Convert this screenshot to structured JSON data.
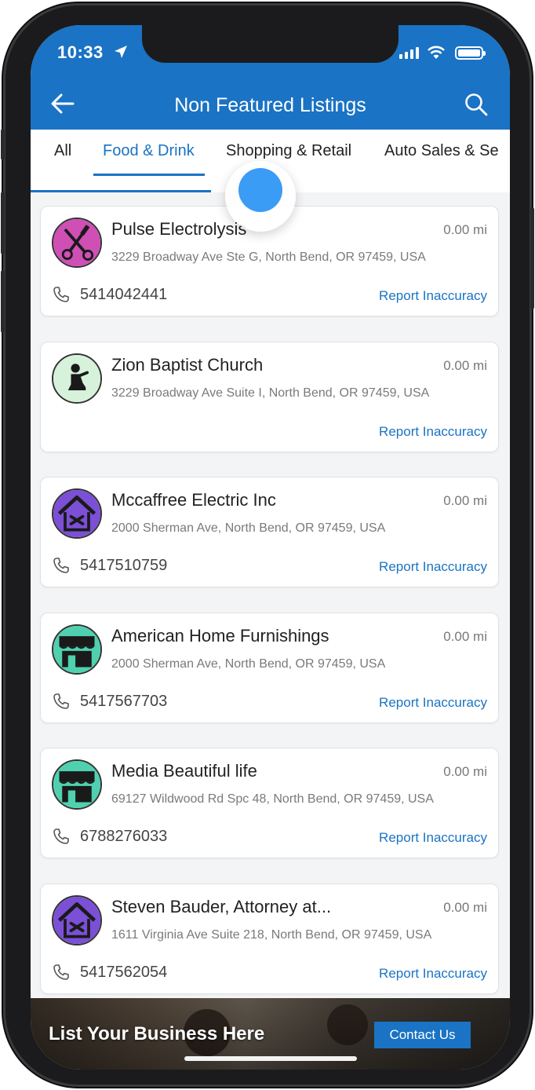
{
  "status_bar": {
    "time": "10:33"
  },
  "header": {
    "title": "Non Featured Listings"
  },
  "tabs": [
    {
      "label": "All"
    },
    {
      "label": "Food & Drink"
    },
    {
      "label": "Shopping & Retail"
    },
    {
      "label": "Auto Sales & Se"
    }
  ],
  "active_tab": "Food & Drink",
  "listings": [
    {
      "name": "Pulse Electrolysis",
      "distance": "0.00 mi",
      "address": "3229 Broadway Ave Ste G, North Bend, OR 97459, USA",
      "phone": "5414042441",
      "report_label": "Report Inaccuracy",
      "icon": "salon-scissors-icon"
    },
    {
      "name": "Zion Baptist Church",
      "distance": "0.00 mi",
      "address": "3229 Broadway Ave Suite I, North Bend, OR 97459, USA",
      "phone": "",
      "report_label": "Report Inaccuracy",
      "icon": "praying-person-icon"
    },
    {
      "name": "Mccaffree Electric Inc",
      "distance": "0.00 mi",
      "address": "2000 Sherman Ave, North Bend, OR 97459, USA",
      "phone": "5417510759",
      "report_label": "Report Inaccuracy",
      "icon": "home-services-icon"
    },
    {
      "name": "American Home Furnishings",
      "distance": "0.00 mi",
      "address": "2000 Sherman Ave, North Bend, OR 97459, USA",
      "phone": "5417567703",
      "report_label": "Report Inaccuracy",
      "icon": "storefront-icon"
    },
    {
      "name": "Media Beautiful life",
      "distance": "0.00 mi",
      "address": "69127 Wildwood Rd Spc 48, North Bend, OR 97459, USA",
      "phone": "6788276033",
      "report_label": "Report Inaccuracy",
      "icon": "storefront-icon"
    },
    {
      "name": "Steven Bauder, Attorney at...",
      "distance": "0.00 mi",
      "address": "1611 Virginia Ave Suite 218, North Bend, OR 97459, USA",
      "phone": "5417562054",
      "report_label": "Report Inaccuracy",
      "icon": "home-services-icon"
    }
  ],
  "banner": {
    "text": "List Your Business Here",
    "button_label": "Contact Us"
  },
  "colors": {
    "primary": "#1a73c4",
    "touch_indicator": "#3a9cf5",
    "background": "#f3f4f6"
  }
}
